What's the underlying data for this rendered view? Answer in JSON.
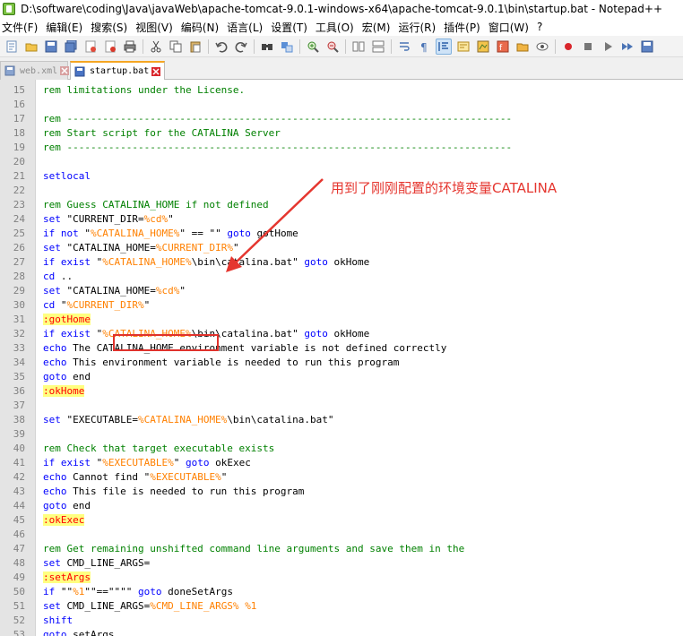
{
  "window": {
    "title": "D:\\software\\coding\\Java\\javaWeb\\apache-tomcat-9.0.1-windows-x64\\apache-tomcat-9.0.1\\bin\\startup.bat - Notepad++"
  },
  "menu": [
    {
      "label": "文件(F)"
    },
    {
      "label": "编辑(E)"
    },
    {
      "label": "搜索(S)"
    },
    {
      "label": "视图(V)"
    },
    {
      "label": "编码(N)"
    },
    {
      "label": "语言(L)"
    },
    {
      "label": "设置(T)"
    },
    {
      "label": "工具(O)"
    },
    {
      "label": "宏(M)"
    },
    {
      "label": "运行(R)"
    },
    {
      "label": "插件(P)"
    },
    {
      "label": "窗口(W)"
    },
    {
      "label": "?"
    }
  ],
  "tabs": [
    {
      "label": "web.xml",
      "active": false
    },
    {
      "label": "startup.bat",
      "active": true
    }
  ],
  "annotation": {
    "text": "用到了刚刚配置的环境变量CATALINA",
    "color": "#e5362f"
  },
  "colors": {
    "comment": "#008000",
    "keyword": "#0000ff",
    "variable": "#ff8000",
    "label_bg": "#ffff80",
    "label_fg": "#ff0000"
  },
  "code_lines": [
    {
      "n": "15",
      "segs": [
        [
          "rem",
          "rem limitations under the License."
        ]
      ]
    },
    {
      "n": "16",
      "segs": []
    },
    {
      "n": "17",
      "segs": [
        [
          "rem",
          "rem ---------------------------------------------------------------------------"
        ]
      ]
    },
    {
      "n": "18",
      "segs": [
        [
          "rem",
          "rem Start script for the CATALINA Server"
        ]
      ]
    },
    {
      "n": "19",
      "segs": [
        [
          "rem",
          "rem ---------------------------------------------------------------------------"
        ]
      ]
    },
    {
      "n": "20",
      "segs": []
    },
    {
      "n": "21",
      "segs": [
        [
          "kw",
          "setlocal"
        ]
      ]
    },
    {
      "n": "22",
      "segs": []
    },
    {
      "n": "23",
      "segs": [
        [
          "rem",
          "rem Guess CATALINA_HOME if not defined"
        ]
      ]
    },
    {
      "n": "24",
      "segs": [
        [
          "kw",
          "set"
        ],
        [
          "str",
          " \"CURRENT_DIR="
        ],
        [
          "var",
          "%cd%"
        ],
        [
          "str",
          "\""
        ]
      ]
    },
    {
      "n": "25",
      "segs": [
        [
          "kw",
          "if not"
        ],
        [
          "str",
          " \""
        ],
        [
          "var",
          "%CATALINA_HOME%"
        ],
        [
          "str",
          "\" == \"\" "
        ],
        [
          "kw",
          "goto"
        ],
        [
          "str",
          " gotHome"
        ]
      ]
    },
    {
      "n": "26",
      "segs": [
        [
          "kw",
          "set"
        ],
        [
          "str",
          " \"CATALINA_HOME="
        ],
        [
          "var",
          "%CURRENT_DIR%"
        ],
        [
          "str",
          "\""
        ]
      ]
    },
    {
      "n": "27",
      "segs": [
        [
          "kw",
          "if exist"
        ],
        [
          "str",
          " \""
        ],
        [
          "var",
          "%CATALINA_HOME%"
        ],
        [
          "str",
          "\\bin\\catalina.bat\" "
        ],
        [
          "kw",
          "goto"
        ],
        [
          "str",
          " okHome"
        ]
      ]
    },
    {
      "n": "28",
      "segs": [
        [
          "kw",
          "cd"
        ],
        [
          "str",
          " .."
        ]
      ]
    },
    {
      "n": "29",
      "segs": [
        [
          "kw",
          "set"
        ],
        [
          "str",
          " \"CATALINA_HOME="
        ],
        [
          "var",
          "%cd%"
        ],
        [
          "str",
          "\""
        ]
      ]
    },
    {
      "n": "30",
      "segs": [
        [
          "kw",
          "cd"
        ],
        [
          "str",
          " \""
        ],
        [
          "var",
          "%CURRENT_DIR%"
        ],
        [
          "str",
          "\""
        ]
      ]
    },
    {
      "n": "31",
      "segs": [
        [
          "label",
          ":gotHome"
        ]
      ]
    },
    {
      "n": "32",
      "segs": [
        [
          "kw",
          "if exist"
        ],
        [
          "str",
          " \""
        ],
        [
          "var",
          "%CATALINA_HOME%"
        ],
        [
          "str",
          "\\bin\\catalina.bat\" "
        ],
        [
          "kw",
          "goto"
        ],
        [
          "str",
          " okHome"
        ]
      ]
    },
    {
      "n": "33",
      "segs": [
        [
          "kw",
          "echo"
        ],
        [
          "str",
          " The CATALINA_HOME environment variable is not defined correctly"
        ]
      ]
    },
    {
      "n": "34",
      "segs": [
        [
          "kw",
          "echo"
        ],
        [
          "str",
          " This environment variable is needed to run this program"
        ]
      ]
    },
    {
      "n": "35",
      "segs": [
        [
          "kw",
          "goto"
        ],
        [
          "str",
          " end"
        ]
      ]
    },
    {
      "n": "36",
      "segs": [
        [
          "label",
          ":okHome"
        ]
      ]
    },
    {
      "n": "37",
      "segs": []
    },
    {
      "n": "38",
      "segs": [
        [
          "kw",
          "set"
        ],
        [
          "str",
          " \"EXECUTABLE="
        ],
        [
          "var",
          "%CATALINA_HOME%"
        ],
        [
          "str",
          "\\bin\\catalina.bat\""
        ]
      ]
    },
    {
      "n": "39",
      "segs": []
    },
    {
      "n": "40",
      "segs": [
        [
          "rem",
          "rem Check that target executable exists"
        ]
      ]
    },
    {
      "n": "41",
      "segs": [
        [
          "kw",
          "if exist"
        ],
        [
          "str",
          " \""
        ],
        [
          "var",
          "%EXECUTABLE%"
        ],
        [
          "str",
          "\" "
        ],
        [
          "kw",
          "goto"
        ],
        [
          "str",
          " okExec"
        ]
      ]
    },
    {
      "n": "42",
      "segs": [
        [
          "kw",
          "echo"
        ],
        [
          "str",
          " Cannot find \""
        ],
        [
          "var",
          "%EXECUTABLE%"
        ],
        [
          "str",
          "\""
        ]
      ]
    },
    {
      "n": "43",
      "segs": [
        [
          "kw",
          "echo"
        ],
        [
          "str",
          " This file is needed to run this program"
        ]
      ]
    },
    {
      "n": "44",
      "segs": [
        [
          "kw",
          "goto"
        ],
        [
          "str",
          " end"
        ]
      ]
    },
    {
      "n": "45",
      "segs": [
        [
          "label",
          ":okExec"
        ]
      ]
    },
    {
      "n": "46",
      "segs": []
    },
    {
      "n": "47",
      "segs": [
        [
          "rem",
          "rem Get remaining unshifted command line arguments and save them in the"
        ]
      ]
    },
    {
      "n": "48",
      "segs": [
        [
          "kw",
          "set"
        ],
        [
          "str",
          " CMD_LINE_ARGS="
        ]
      ]
    },
    {
      "n": "49",
      "segs": [
        [
          "label",
          ":setArgs"
        ]
      ]
    },
    {
      "n": "50",
      "segs": [
        [
          "kw",
          "if"
        ],
        [
          "str",
          " \"\""
        ],
        [
          "var",
          "%1"
        ],
        [
          "str",
          "\"\"==\"\"\"\" "
        ],
        [
          "kw",
          "goto"
        ],
        [
          "str",
          " doneSetArgs"
        ]
      ]
    },
    {
      "n": "51",
      "segs": [
        [
          "kw",
          "set"
        ],
        [
          "str",
          " CMD_LINE_ARGS="
        ],
        [
          "var",
          "%CMD_LINE_ARGS%"
        ],
        [
          "str",
          " "
        ],
        [
          "var",
          "%1"
        ]
      ]
    },
    {
      "n": "52",
      "segs": [
        [
          "kw",
          "shift"
        ]
      ]
    },
    {
      "n": "53",
      "segs": [
        [
          "kw",
          "goto"
        ],
        [
          "str",
          " setArgs"
        ]
      ]
    }
  ]
}
